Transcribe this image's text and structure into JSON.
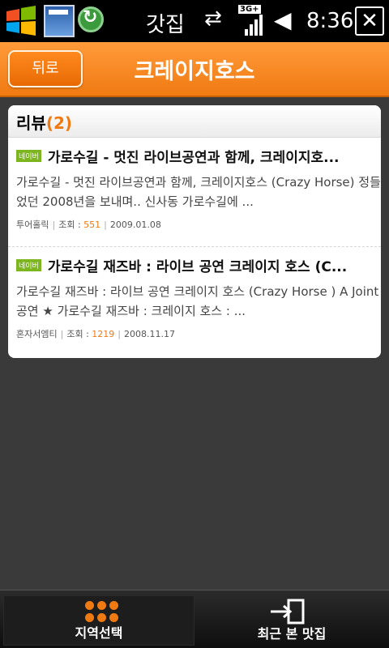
{
  "status_bar": {
    "title": "갓집",
    "network": "3G+",
    "time": "8:36",
    "close": "✕"
  },
  "header": {
    "back_label": "뒤로",
    "title": "크레이지호스"
  },
  "reviews": {
    "heading": "리뷰",
    "count": "(2)",
    "items": [
      {
        "badge": "네이버",
        "title": "가로수길 - 멋진 라이브공연과 함께, 크레이지호...",
        "body": "가로수길 - 멋진 라이브공연과 함께, 크레이지호스 (Crazy Horse) 정들었던 2008년을 보내며.. 신사동 가로수길에 ...",
        "author": "투어홀릭",
        "views_label": "조회 :",
        "views": "551",
        "date": "2009.01.08"
      },
      {
        "badge": "네이버",
        "title": "가로수길 재즈바 : 라이브 공연 크레이지 호스 (C...",
        "body": "가로수길 재즈바 : 라이브 공연 크레이지 호스 (Crazy Horse ) A Joint 공연 ★ 가로수길 재즈바 : 크레이지 호스 : ...",
        "author": "혼자서엠티",
        "views_label": "조회 :",
        "views": "1219",
        "date": "2008.11.17"
      }
    ]
  },
  "bottom_bar": {
    "region_label": "지역선택",
    "recent_label": "최근 본 맛집"
  },
  "colors": {
    "accent": "#f07a12",
    "badge": "#7cb51d"
  }
}
